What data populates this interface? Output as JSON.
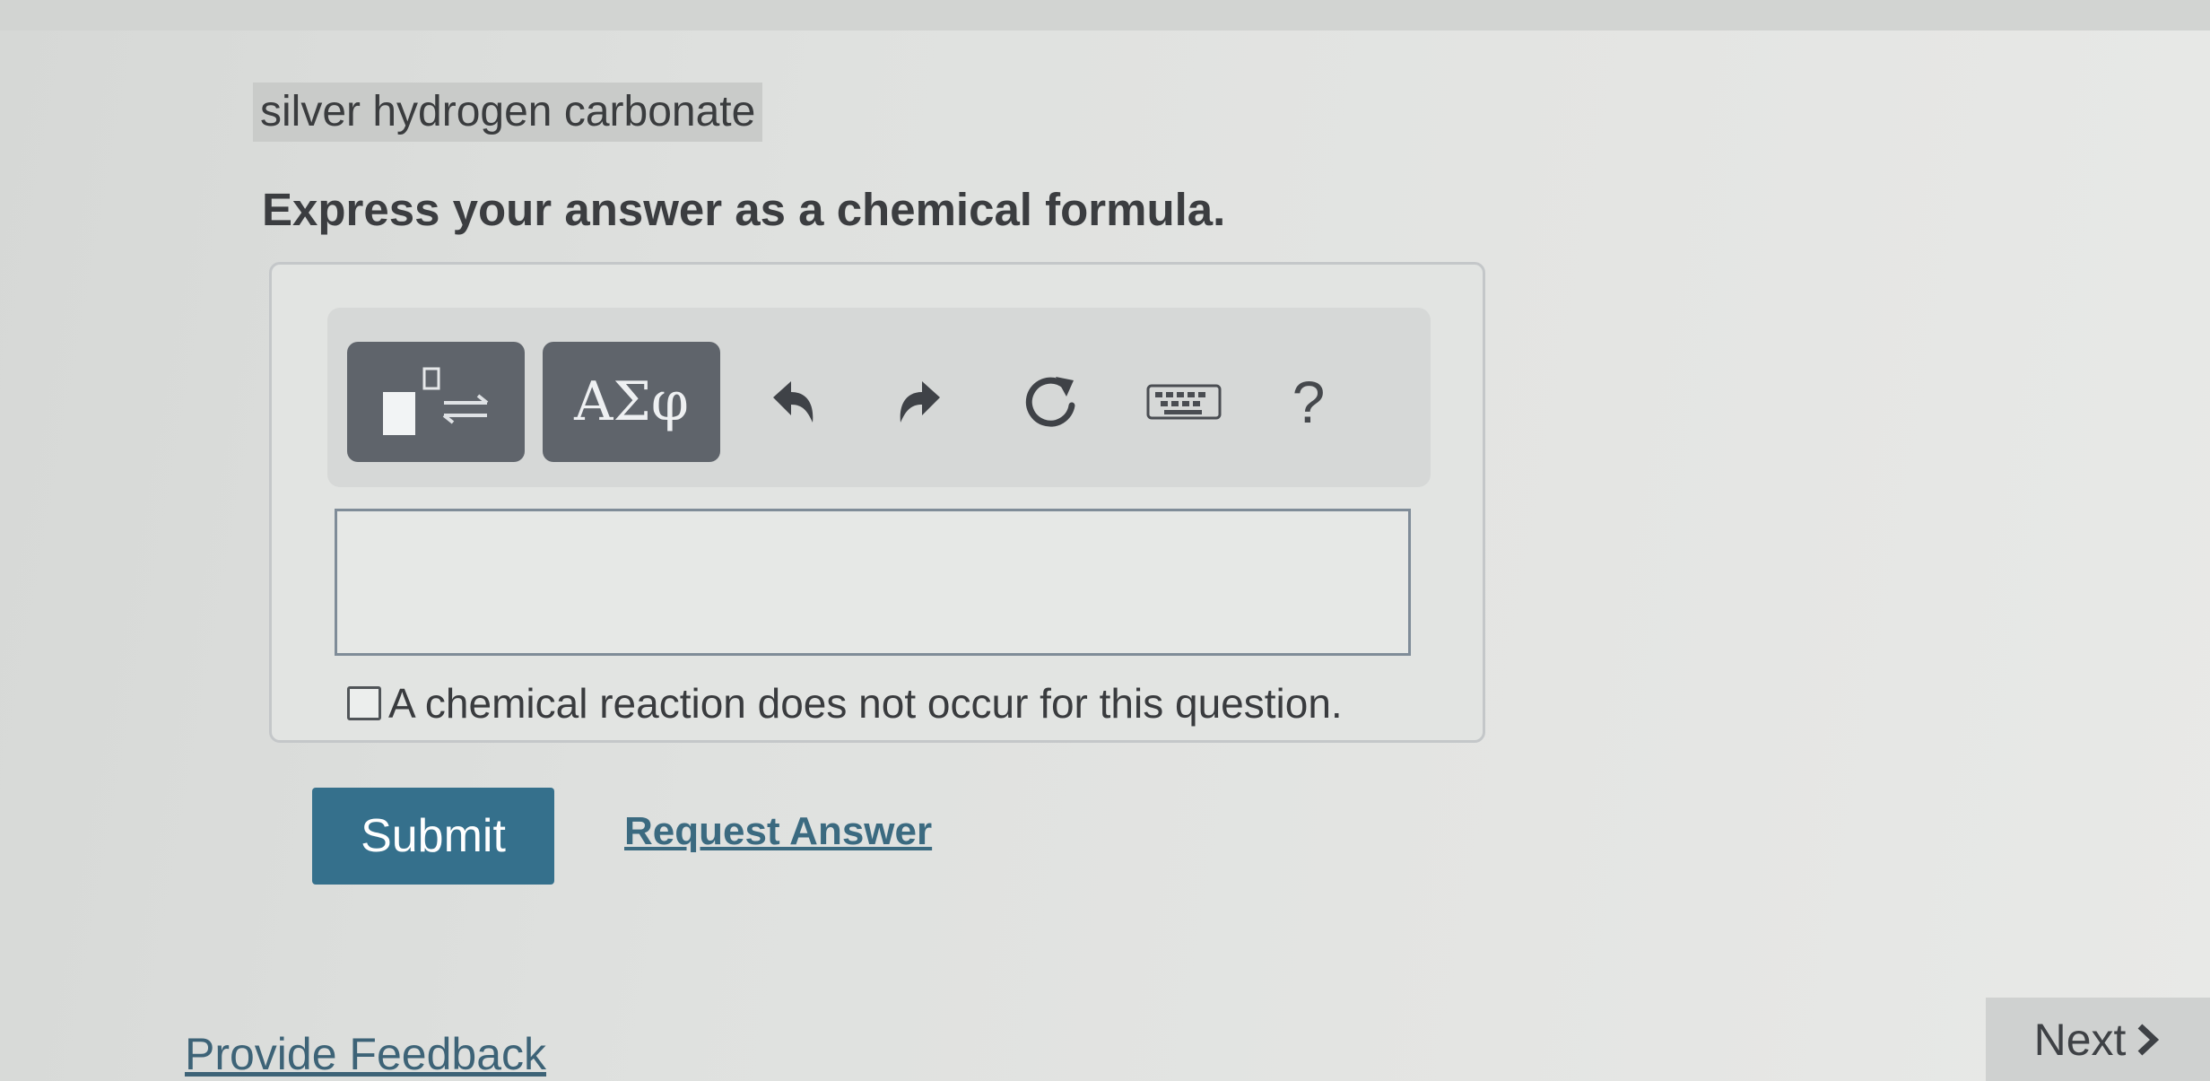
{
  "question": {
    "label": "silver hydrogen carbonate",
    "instruction": "Express your answer as a chemical formula."
  },
  "toolbar": {
    "templates_icon": "templates-icon",
    "symbols_label": "ΑΣφ",
    "undo_icon": "undo-icon",
    "redo_icon": "redo-icon",
    "reset_icon": "reset-icon",
    "keyboard_icon": "keyboard-icon",
    "help_label": "?"
  },
  "answer": {
    "value": "",
    "no_reaction_label": "A chemical reaction does not occur for this question.",
    "no_reaction_checked": false
  },
  "actions": {
    "submit_label": "Submit",
    "request_answer_label": "Request Answer"
  },
  "footer": {
    "feedback_label": "Provide Feedback",
    "next_label": "Next"
  },
  "colors": {
    "submit_bg": "#35708c",
    "toolbar_button_bg": "#5f646b",
    "link": "#3b6a80"
  }
}
